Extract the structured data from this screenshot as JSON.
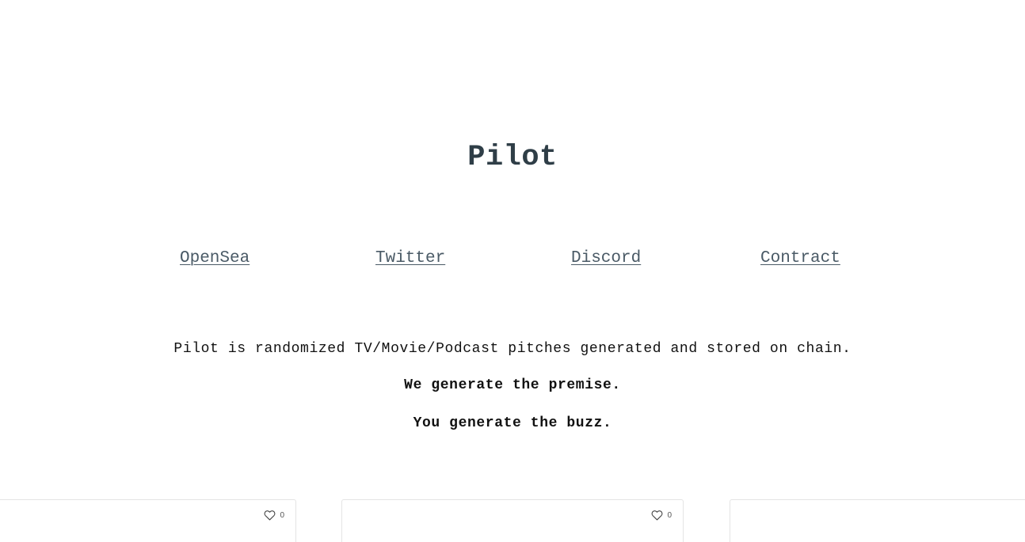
{
  "header": {
    "title": "Pilot"
  },
  "nav": {
    "links": [
      {
        "label": "OpenSea"
      },
      {
        "label": "Twitter"
      },
      {
        "label": "Discord"
      },
      {
        "label": "Contract"
      }
    ]
  },
  "intro": {
    "description": "Pilot is randomized TV/Movie/Podcast pitches generated and stored on chain.",
    "line1": "We generate the premise.",
    "line2": "You generate the buzz."
  },
  "cards": [
    {
      "likes": "0",
      "icon": "heart-icon"
    },
    {
      "likes": "0",
      "icon": "heart-icon"
    },
    {}
  ],
  "colors": {
    "title": "#2f3e47",
    "link": "#4a5a66",
    "text": "#111111",
    "card_border": "#e4e4e4"
  }
}
